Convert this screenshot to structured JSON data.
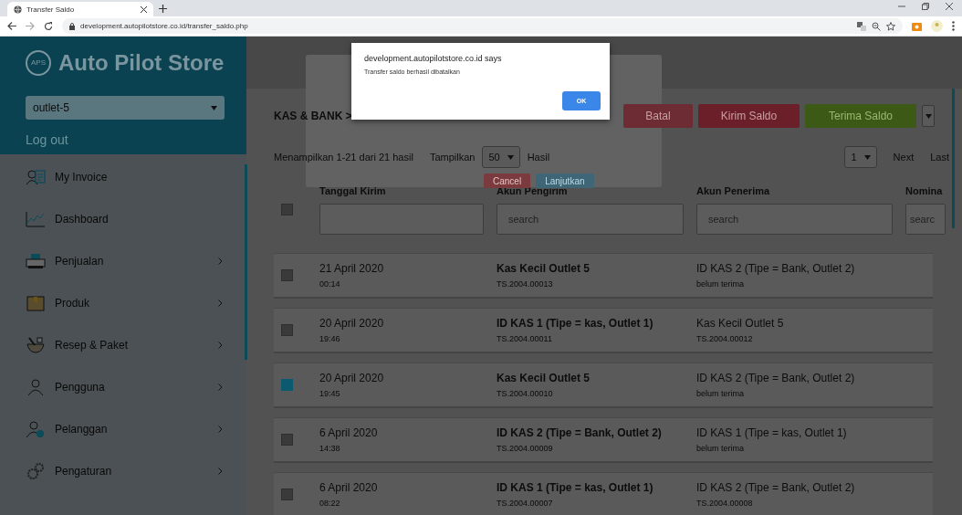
{
  "browser": {
    "tab_title": "Transfer Saldo",
    "url": "development.autopilotstore.co.id/transfer_saldo.php"
  },
  "sidebar": {
    "logo_badge": "APS",
    "logo": "Auto Pilot Store",
    "outlet": "outlet-5",
    "logout": "Log out",
    "items": [
      {
        "label": "My Invoice",
        "has_submenu": false
      },
      {
        "label": "Dashboard",
        "has_submenu": false
      },
      {
        "label": "Penjualan",
        "has_submenu": true
      },
      {
        "label": "Produk",
        "has_submenu": true
      },
      {
        "label": "Resep & Paket",
        "has_submenu": true
      },
      {
        "label": "Pengguna",
        "has_submenu": true
      },
      {
        "label": "Pelanggan",
        "has_submenu": true
      },
      {
        "label": "Pengaturan",
        "has_submenu": true
      }
    ]
  },
  "breadcrumb": "KAS & BANK >",
  "actions": [
    {
      "label": "Batal",
      "kind": "cancel"
    },
    {
      "label": "Kirim Saldo",
      "kind": "send"
    },
    {
      "label": "Terima Saldo",
      "kind": "receive"
    }
  ],
  "pager": {
    "summary": "Menampilkan 1-21 dari 21 hasil",
    "show_label": "Tampilkan",
    "per_page": "50",
    "per_page_suffix": "Hasil",
    "page": "1",
    "next": "Next",
    "last": "Last"
  },
  "confirm_panel": {
    "buttons": [
      {
        "label": "Cancel",
        "kind": "cancel"
      },
      {
        "label": "Lanjutkan",
        "kind": "continue"
      }
    ]
  },
  "table": {
    "header_checked": false,
    "columns": [
      {
        "label": "Tanggal Kirim"
      },
      {
        "label": "Akun Pengirim",
        "placeholder": "search"
      },
      {
        "label": "Akun Penerima",
        "placeholder": "search"
      },
      {
        "label": "Nomina",
        "placeholder": "searc"
      }
    ],
    "rows": [
      {
        "selected": false,
        "date": "21 April 2020",
        "time": "00:14",
        "sender": "Kas Kecil Outlet 5",
        "sender_code": "TS.2004.00013",
        "receiver": "ID KAS 2 (Tipe = Bank, Outlet 2)",
        "receiver_note": "belum terima"
      },
      {
        "selected": false,
        "date": "20 April 2020",
        "time": "19:46",
        "sender": "ID KAS 1 (Tipe = kas, Outlet 1)",
        "sender_code": "TS.2004.00011",
        "receiver": "Kas Kecil Outlet 5",
        "receiver_note": "TS.2004.00012"
      },
      {
        "selected": true,
        "date": "20 April 2020",
        "time": "19:45",
        "sender": "Kas Kecil Outlet 5",
        "sender_code": "TS.2004.00010",
        "receiver": "ID KAS 2 (Tipe = Bank, Outlet 2)",
        "receiver_note": "belum terima"
      },
      {
        "selected": false,
        "date": "6 April 2020",
        "time": "14:38",
        "sender": "ID KAS 2 (Tipe = Bank, Outlet 2)",
        "sender_code": "TS.2004.00009",
        "receiver": "ID KAS 1 (Tipe = kas, Outlet 1)",
        "receiver_note": "belum terima"
      },
      {
        "selected": false,
        "date": "6 April 2020",
        "time": "08:22",
        "sender": "ID KAS 1 (Tipe = kas, Outlet 1)",
        "sender_code": "TS.2004.00007",
        "receiver": "ID KAS 2 (Tipe = Bank, Outlet 2)",
        "receiver_note": "TS.2004.00008"
      }
    ]
  },
  "dialog": {
    "origin": "development.autopilotstore.co.id says",
    "message": "Transfer saldo berhasil dibatalkan",
    "button": "OK"
  }
}
